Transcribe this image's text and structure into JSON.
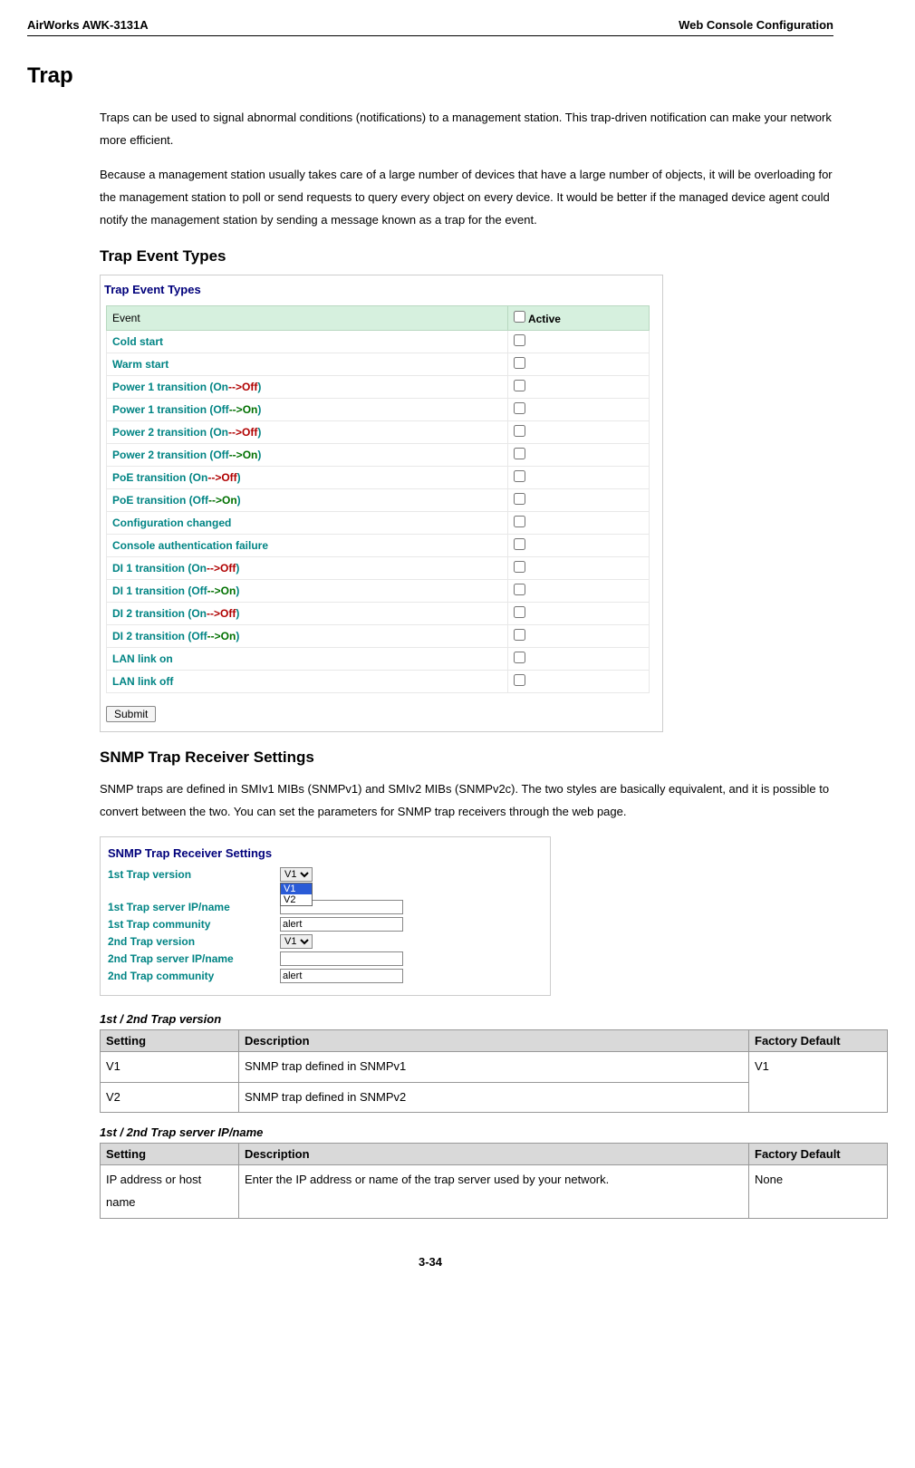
{
  "header": {
    "left": "AirWorks AWK-3131A",
    "right": "Web Console Configuration"
  },
  "title": "Trap",
  "para1": "Traps can be used to signal abnormal conditions (notifications) to a management station. This trap-driven notification can make your network more efficient.",
  "para2": "Because a management station usually takes care of a large number of devices that have a large number of objects, it will be overloading for the management station to poll or send requests to query every object on every device. It would be better if the managed device agent could notify the management station by sending a message known as a trap for the event.",
  "section_trap_types": "Trap Event Types",
  "trap_ss_title": "Trap Event Types",
  "trap_headers": {
    "event": "Event",
    "active": "Active"
  },
  "trap_events": [
    {
      "label": "Cold start"
    },
    {
      "label": "Warm start"
    },
    {
      "prefix": "Power 1 transition (On",
      "arrow": "-->Off",
      "suffix": ")"
    },
    {
      "prefix": "Power 1 transition (Off",
      "arrow": "-->On",
      "suffix": ")"
    },
    {
      "prefix": "Power 2 transition (On",
      "arrow": "-->Off",
      "suffix": ")"
    },
    {
      "prefix": "Power 2 transition (Off",
      "arrow": "-->On",
      "suffix": ")"
    },
    {
      "prefix": "PoE transition (On",
      "arrow": "-->Off",
      "suffix": ")"
    },
    {
      "prefix": "PoE transition (Off",
      "arrow": "-->On",
      "suffix": ")"
    },
    {
      "label": "Configuration changed"
    },
    {
      "label": "Console authentication failure"
    },
    {
      "prefix": "DI 1 transition (On",
      "arrow": "-->Off",
      "suffix": ")"
    },
    {
      "prefix": "DI 1 transition (Off",
      "arrow": "-->On",
      "suffix": ")"
    },
    {
      "prefix": "DI 2 transition (On",
      "arrow": "-->Off",
      "suffix": ")"
    },
    {
      "prefix": "DI 2 transition (Off",
      "arrow": "-->On",
      "suffix": ")"
    },
    {
      "label": "LAN link on"
    },
    {
      "label": "LAN link off"
    }
  ],
  "submit_label": "Submit",
  "section_snmp": "SNMP Trap Receiver Settings",
  "snmp_para": "SNMP traps are defined in SMIv1 MIBs (SNMPv1) and SMIv2 MIBs (SNMPv2c). The two styles are basically equivalent, and it is possible to convert between the two. You can set the parameters for SNMP trap receivers through the web page.",
  "snmp_ss_title": "SNMP Trap Receiver Settings",
  "snmp_fields": {
    "v1_label": "1st Trap version",
    "v1_value": "V1",
    "v1_opts": [
      "V1",
      "V2"
    ],
    "s1_label": "1st Trap server IP/name",
    "s1_value": "",
    "c1_label": "1st Trap community",
    "c1_value": "alert",
    "v2_label": "2nd Trap version",
    "v2_value": "V1",
    "s2_label": "2nd Trap server IP/name",
    "s2_value": "",
    "c2_label": "2nd Trap community",
    "c2_value": "alert"
  },
  "tbl1_caption": "1st / 2nd Trap version",
  "tbl_headers": {
    "setting": "Setting",
    "desc": "Description",
    "default": "Factory Default"
  },
  "tbl1_rows": [
    {
      "setting": "V1",
      "desc": "SNMP trap defined in SNMPv1",
      "default": "V1"
    },
    {
      "setting": "V2",
      "desc": "SNMP trap defined in SNMPv2"
    }
  ],
  "tbl2_caption": "1st / 2nd Trap server IP/name",
  "tbl2_rows": [
    {
      "setting": "IP address or host name",
      "desc": "Enter the IP address or name of the trap server used by your network.",
      "default": "None"
    }
  ],
  "footer": "3-34"
}
